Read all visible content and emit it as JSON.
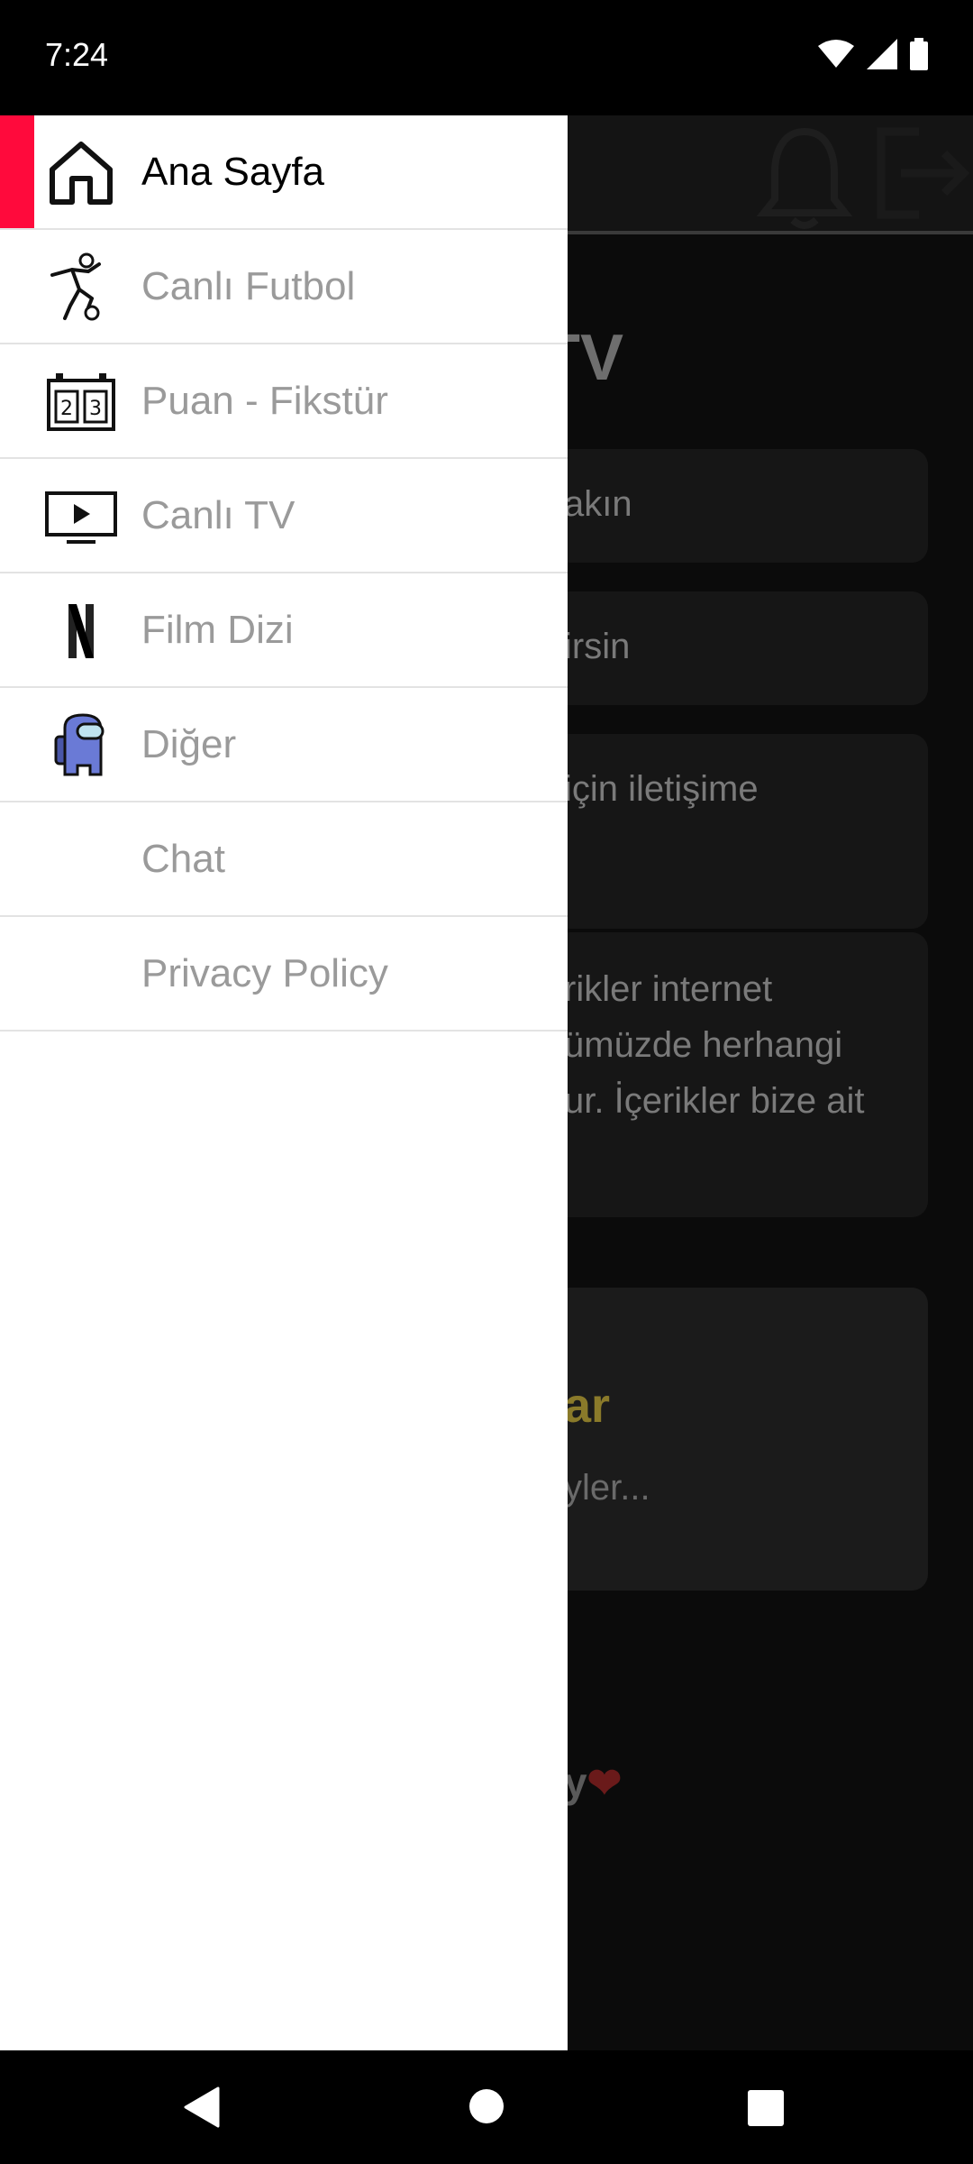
{
  "status_bar": {
    "time": "7:24"
  },
  "background": {
    "title": "TV",
    "cards": [
      {
        "text": "akın"
      },
      {
        "text": "irsin"
      },
      {
        "text": "için iletişime"
      },
      {
        "lines": [
          "rikler internet",
          "ümüzde herhangi",
          "ur. İçerikler bize ait"
        ]
      }
    ],
    "accent_title": "ar",
    "accent_sub": "yler...",
    "footer": "y",
    "footer_heart": "❤"
  },
  "drawer": {
    "items": [
      {
        "label": "Ana Sayfa",
        "icon": "home-icon",
        "active": true
      },
      {
        "label": "Canlı Futbol",
        "icon": "football-player-icon",
        "active": false
      },
      {
        "label": "Puan - Fikstür",
        "icon": "scoreboard-icon",
        "active": false
      },
      {
        "label": "Canlı TV",
        "icon": "tv-icon",
        "active": false
      },
      {
        "label": "Film Dizi",
        "icon": "netflix-icon",
        "active": false
      },
      {
        "label": "Diğer",
        "icon": "among-us-icon",
        "active": false
      },
      {
        "label": "Chat",
        "icon": "",
        "active": false
      },
      {
        "label": "Privacy Policy",
        "icon": "",
        "active": false
      }
    ]
  },
  "colors": {
    "accent": "#ff0a3c",
    "drawer_bg": "#ffffff",
    "inactive_text": "#9a9a9a"
  }
}
